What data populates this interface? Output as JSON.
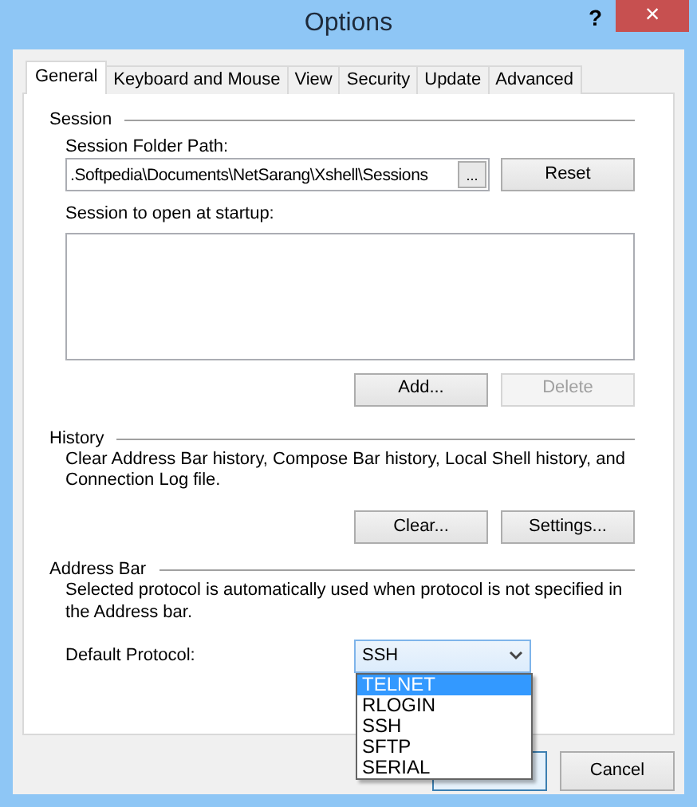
{
  "window": {
    "title": "Options",
    "help": "?",
    "close": "×"
  },
  "tabs": [
    {
      "label": "General",
      "selected": true
    },
    {
      "label": "Keyboard and Mouse",
      "selected": false
    },
    {
      "label": "View",
      "selected": false
    },
    {
      "label": "Security",
      "selected": false
    },
    {
      "label": "Update",
      "selected": false
    },
    {
      "label": "Advanced",
      "selected": false
    }
  ],
  "session": {
    "heading": "Session",
    "folder_label": "Session Folder Path:",
    "folder_value": ".Softpedia\\Documents\\NetSarang\\Xshell\\Sessions",
    "browse_button": "...",
    "reset_button": "Reset",
    "startup_label": "Session to open at startup:",
    "add_button": "Add...",
    "delete_button": "Delete",
    "delete_disabled": true
  },
  "history": {
    "heading": "History",
    "description": "Clear Address Bar history, Compose Bar history, Local Shell history, and Connection Log file.",
    "clear_button": "Clear...",
    "settings_button": "Settings..."
  },
  "address_bar": {
    "heading": "Address Bar",
    "description": "Selected protocol is automatically used when protocol is not specified in the Address bar.",
    "protocol_label": "Default Protocol:",
    "protocol_value": "SSH",
    "dropdown_open": true,
    "options": [
      {
        "label": "TELNET",
        "selected": true
      },
      {
        "label": "RLOGIN",
        "selected": false
      },
      {
        "label": "SSH",
        "selected": false
      },
      {
        "label": "SFTP",
        "selected": false
      },
      {
        "label": "SERIAL",
        "selected": false
      }
    ]
  },
  "footer": {
    "cancel_button": "Cancel"
  }
}
